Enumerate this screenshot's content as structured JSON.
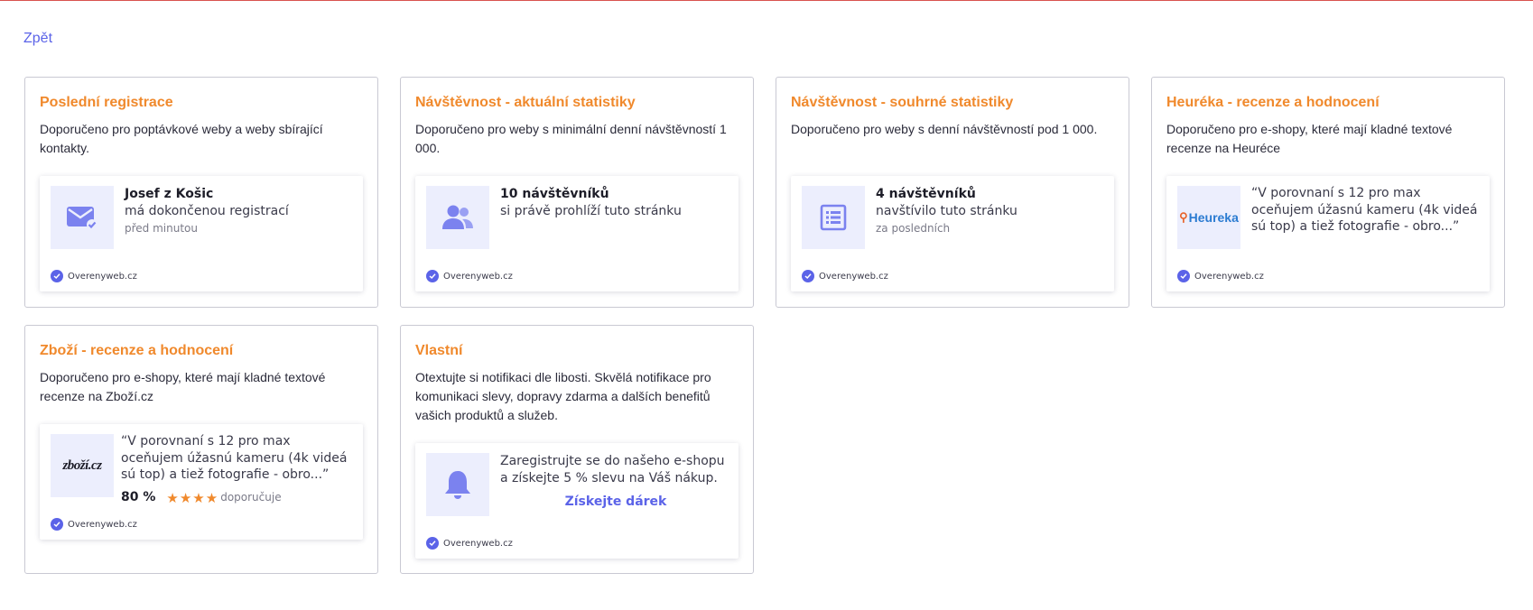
{
  "nav": {
    "back_label": "Zpět"
  },
  "brand": {
    "accent": "#5b63e8",
    "title_color": "#f0892c"
  },
  "cards": [
    {
      "title": "Poslední registrace",
      "description": "Doporučeno pro poptávkové weby a weby sbírající kontakty.",
      "icon": "envelope-check-icon",
      "notification": {
        "headline": "Josef z Košic",
        "text": "má dokončenou registrací",
        "meta": "před minutou",
        "verified": "Overenyweb.cz"
      }
    },
    {
      "title": "Návštěvnost - aktuální statistiky",
      "description": "Doporučeno pro weby s minimální denní návštěvností 1 000.",
      "icon": "users-icon",
      "notification": {
        "headline": "10 návštěvníků",
        "text": "si právě prohlíží tuto stránku",
        "verified": "Overenyweb.cz"
      }
    },
    {
      "title": "Návštěvnost - souhrné statistiky",
      "description": "Doporučeno pro weby s denní návštěvností pod 1 000.",
      "icon": "list-icon",
      "notification": {
        "headline": "4 návštěvníků",
        "text": "navštívilo tuto stránku",
        "meta": "za posledních",
        "verified": "Overenyweb.cz"
      }
    },
    {
      "title": "Heuréka - recenze a hodnocení",
      "description": "Doporučeno pro e-shopy, které mají kladné textové recenze na Heuréce",
      "icon": "heureka-logo",
      "logo_text": "Heureka",
      "notification": {
        "quote": "“V porovnaní s 12 pro max oceňujem úžasnú kameru (4k videá sú top) a tiež fotografie - obro...”",
        "verified": "Overenyweb.cz"
      }
    },
    {
      "title": "Zboží - recenze a hodnocení",
      "description": "Doporučeno pro e-shopy, které mají kladné textové recenze na Zboží.cz",
      "icon": "zbozi-logo",
      "logo_text": "zboží.cz",
      "notification": {
        "quote": "“V porovnaní s 12 pro max oceňujem úžasnú kameru (4k videá sú top) a tiež fotografie - obro...”",
        "rating_percent": "80 %",
        "rating_stars": 4,
        "rating_label": "doporučuje",
        "verified": "Overenyweb.cz"
      }
    },
    {
      "title": "Vlastní",
      "description": "Otextujte si notifikaci dle libosti. Skvělá notifikace pro komunikaci slevy, dopravy zdarma a dalších benefitů vašich produktů a služeb.",
      "icon": "bell-icon",
      "notification": {
        "text": "Zaregistrujte se do našeho e-shopu a získejte 5 % slevu na Váš nákup.",
        "cta": "Získejte dárek",
        "verified": "Overenyweb.cz"
      }
    }
  ]
}
